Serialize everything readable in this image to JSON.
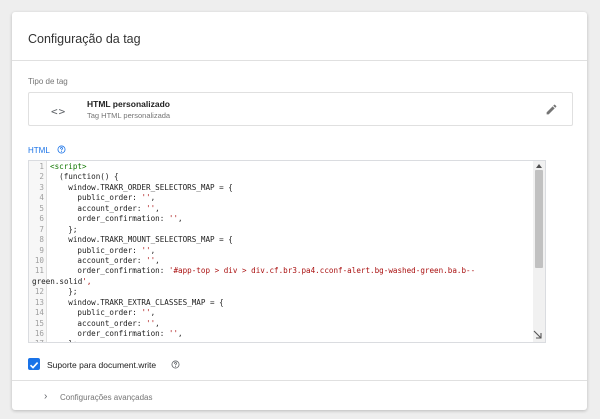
{
  "card": {
    "title": "Configuração da tag",
    "tag_type_label": "Tipo de tag",
    "tag_type": {
      "icon": "code-brackets-icon",
      "glyph": "<>",
      "name": "HTML personalizado",
      "subtitle": "Tag HTML personalizada"
    },
    "html_label": "HTML",
    "code_lines": [
      {
        "n": "1",
        "text": "<script>"
      },
      {
        "n": "2",
        "text": "  (function() {"
      },
      {
        "n": "3",
        "text": "    window.TRAKR_ORDER_SELECTORS_MAP = {"
      },
      {
        "n": "4",
        "text": "      public_order: '',"
      },
      {
        "n": "5",
        "text": "      account_order: '',"
      },
      {
        "n": "6",
        "text": "      order_confirmation: '',"
      },
      {
        "n": "7",
        "text": "    };"
      },
      {
        "n": "8",
        "text": "    window.TRAKR_MOUNT_SELECTORS_MAP = {"
      },
      {
        "n": "9",
        "text": "      public_order: '',"
      },
      {
        "n": "10",
        "text": "      account_order: '',"
      },
      {
        "n": "11",
        "text": "      order_confirmation: '#app-top > div > div.cf.br3.pa4.cconf-alert.bg-washed-green.ba.b--"
      },
      {
        "n": "",
        "text": "green.solid',"
      },
      {
        "n": "12",
        "text": "    };"
      },
      {
        "n": "13",
        "text": "    window.TRAKR_EXTRA_CLASSES_MAP = {"
      },
      {
        "n": "14",
        "text": "      public_order: '',"
      },
      {
        "n": "15",
        "text": "      account_order: '',"
      },
      {
        "n": "16",
        "text": "      order_confirmation: '',"
      },
      {
        "n": "17",
        "text": "    };"
      },
      {
        "n": "18",
        "text": "    window.TRAKR_EXTRA_STYLES_MAP = {"
      }
    ],
    "document_write": {
      "checked": true,
      "label": "Suporte para document.write"
    },
    "advanced": {
      "chevron": "›",
      "label": "Configurações avançadas"
    }
  },
  "colors": {
    "accent": "#1a73e8",
    "code_tag": "#117700",
    "code_string": "#aa1111"
  }
}
